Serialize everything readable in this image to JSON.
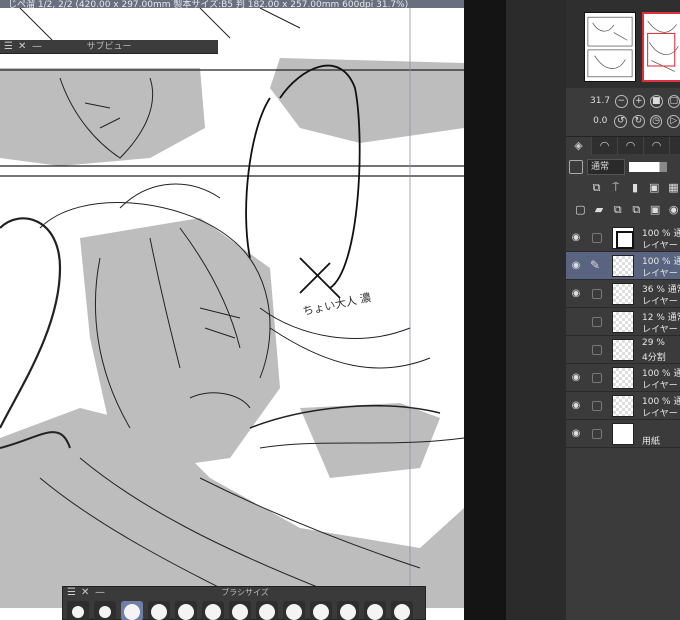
{
  "window": {
    "title": "じぺ溜 1/2, 2/2 (420.00 x 297.00mm 製本サイズ:B5 判 182.00 x 257.00mm 600dpi 31.7%)"
  },
  "subview": {
    "title": "サブビュー",
    "menu_glyph": "☰",
    "close_glyph": "✕",
    "min_glyph": "—"
  },
  "brush_size": {
    "title": "ブラシサイズ",
    "menu_glyph": "☰",
    "close_glyph": "✕",
    "min_glyph": "—",
    "swatch_count": 13,
    "selected_index": 2
  },
  "canvas": {
    "handwritten_note": "ちょい大人 濃"
  },
  "navigator": {
    "zoom": "31.7",
    "rotation": "0.0"
  },
  "layer_panel": {
    "blend_mode": "通常"
  },
  "layers": [
    {
      "visible": true,
      "opacity": "100 %",
      "mode": "通常",
      "name": "レイヤー",
      "thumb": "frame",
      "selected": false,
      "pen": false
    },
    {
      "visible": true,
      "opacity": "100 %",
      "mode": "通常",
      "name": "レイヤー",
      "thumb": "checker",
      "selected": true,
      "pen": true
    },
    {
      "visible": true,
      "opacity": "36 %",
      "mode": "通常",
      "name": "レイヤー",
      "thumb": "checker",
      "selected": false,
      "pen": false
    },
    {
      "visible": false,
      "opacity": "12 %",
      "mode": "通常",
      "name": "レイヤー",
      "thumb": "checker",
      "selected": false,
      "pen": false
    },
    {
      "visible": false,
      "opacity": "29 %",
      "mode": "",
      "name": "4分割",
      "thumb": "checker",
      "selected": false,
      "pen": false
    },
    {
      "visible": true,
      "opacity": "100 %",
      "mode": "通常",
      "name": "レイヤー",
      "thumb": "checker",
      "selected": false,
      "pen": false
    },
    {
      "visible": true,
      "opacity": "100 %",
      "mode": "通常",
      "name": "レイヤー",
      "thumb": "checker",
      "selected": false,
      "pen": false
    },
    {
      "visible": true,
      "opacity": "",
      "mode": "",
      "name": "用紙",
      "thumb": "white",
      "selected": false,
      "pen": false
    }
  ],
  "colors": {
    "selected_layer": "#596480",
    "selected_brush": "#6f7fa8",
    "navigator_frame": "#e03040"
  }
}
